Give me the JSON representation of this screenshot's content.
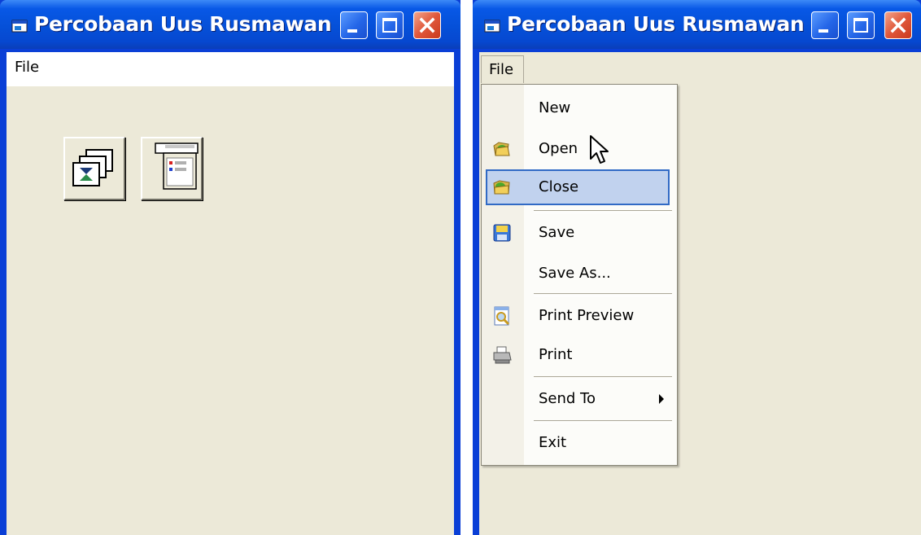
{
  "app": {
    "title": "Percobaan Uus Rusmawan"
  },
  "menubar": {
    "file_label": "File"
  },
  "toolbar": {
    "buttons": [
      {
        "icon": "cascade-windows-icon"
      },
      {
        "icon": "form-layout-icon"
      }
    ]
  },
  "file_menu": {
    "items": [
      {
        "label": "New",
        "icon": ""
      },
      {
        "label": "Open",
        "icon": "open-folder-icon"
      },
      {
        "label": "Close",
        "icon": "close-folder-icon",
        "highlighted": true
      },
      {
        "label": "Save",
        "icon": "floppy-disk-icon"
      },
      {
        "label": "Save As...",
        "icon": ""
      },
      {
        "label": "Print Preview",
        "icon": "print-preview-icon"
      },
      {
        "label": "Print",
        "icon": "printer-icon"
      },
      {
        "label": "Send To",
        "icon": "",
        "submenu": true
      },
      {
        "label": "Exit",
        "icon": ""
      }
    ]
  },
  "colors": {
    "titlebar": "#0550d8",
    "client": "#ece9d8",
    "highlight": "#c1d2ee",
    "highlight_border": "#316ac5"
  }
}
